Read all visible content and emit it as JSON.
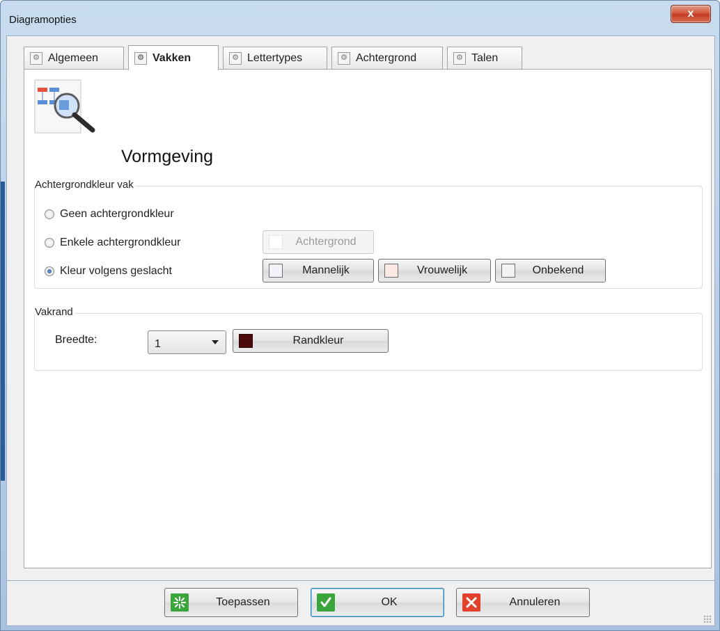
{
  "window": {
    "title": "Diagramopties",
    "close_glyph": "x"
  },
  "tabs": [
    {
      "label": "Algemeen",
      "icon": "settings-page-icon",
      "active": false
    },
    {
      "label": "Vakken",
      "icon": "settings-page-icon",
      "active": true
    },
    {
      "label": "Lettertypes",
      "icon": "settings-page-icon",
      "active": false
    },
    {
      "label": "Achtergrond",
      "icon": "settings-page-icon",
      "active": false
    },
    {
      "label": "Talen",
      "icon": "settings-page-icon",
      "active": false
    }
  ],
  "header": {
    "title": "Vormgeving",
    "icon": "diagram-magnifier-icon"
  },
  "background_group": {
    "label": "Achtergrondkleur vak",
    "options": [
      {
        "label": "Geen achtergrondkleur",
        "selected": false
      },
      {
        "label": "Enkele achtergrondkleur",
        "selected": false
      },
      {
        "label": "Kleur volgens geslacht",
        "selected": true
      }
    ],
    "single_button": {
      "label": "Achtergrond",
      "enabled": false,
      "color": "#ffffff"
    },
    "gender_buttons": [
      {
        "label": "Mannelijk",
        "color": "#f2f4fa"
      },
      {
        "label": "Vrouwelijk",
        "color": "#fce9e4"
      },
      {
        "label": "Onbekend",
        "color": "#f3f3f3"
      }
    ]
  },
  "border_group": {
    "label": "Vakrand",
    "width_label": "Breedte:",
    "width_value": "1",
    "color_button": {
      "label": "Randkleur",
      "color": "#4a0a0a"
    }
  },
  "footer": {
    "apply": {
      "label": "Toepassen",
      "icon": "apply-sparkle-icon",
      "icon_color": "#3aa53a"
    },
    "ok": {
      "label": "OK",
      "icon": "checkmark-icon",
      "icon_color": "#3aa53a"
    },
    "cancel": {
      "label": "Annuleren",
      "icon": "cancel-x-icon",
      "icon_color": "#e2412c"
    }
  }
}
